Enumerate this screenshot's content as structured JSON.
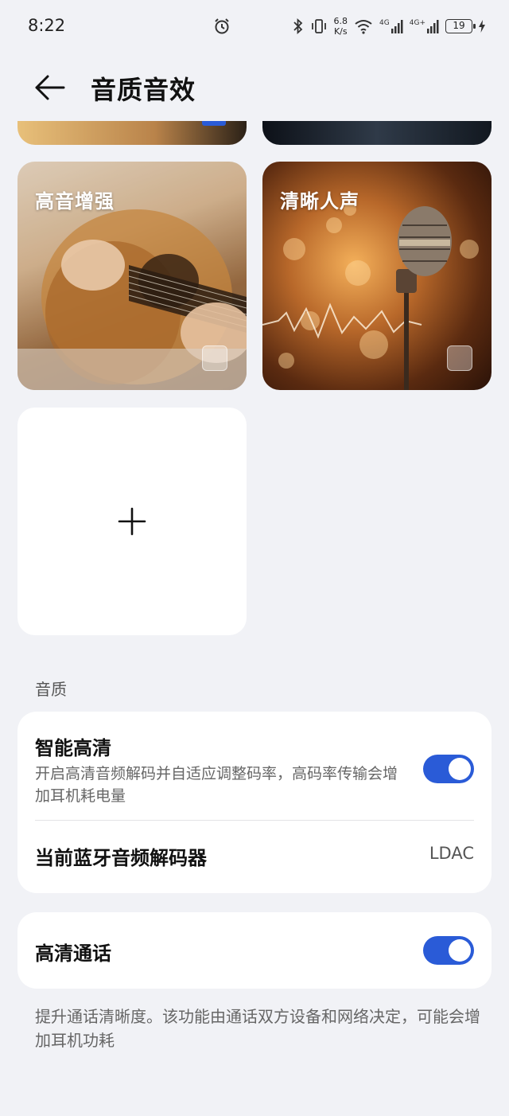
{
  "status_bar": {
    "time": "8:22",
    "net_speed_value": "6.8",
    "net_speed_unit": "K/s",
    "net1": "4G",
    "net2": "4G+",
    "battery": "19"
  },
  "header": {
    "title": "音质音效"
  },
  "effects": [
    {
      "label": "高音增强"
    },
    {
      "label": "清晰人声"
    }
  ],
  "section": {
    "label": "音质"
  },
  "quality": {
    "smart_hd_title": "智能高清",
    "smart_hd_desc": "开启高清音频解码并自适应调整码率，高码率传输会增加耳机耗电量",
    "smart_hd_on": true,
    "codec_title": "当前蓝牙音频解码器",
    "codec_value": "LDAC"
  },
  "call": {
    "title": "高清通话",
    "on": true,
    "footnote": "提升通话清晰度。该功能由通话双方设备和网络决定，可能会增加耳机功耗"
  },
  "colors": {
    "accent": "#2a5bd7",
    "background": "#f1f2f6"
  }
}
